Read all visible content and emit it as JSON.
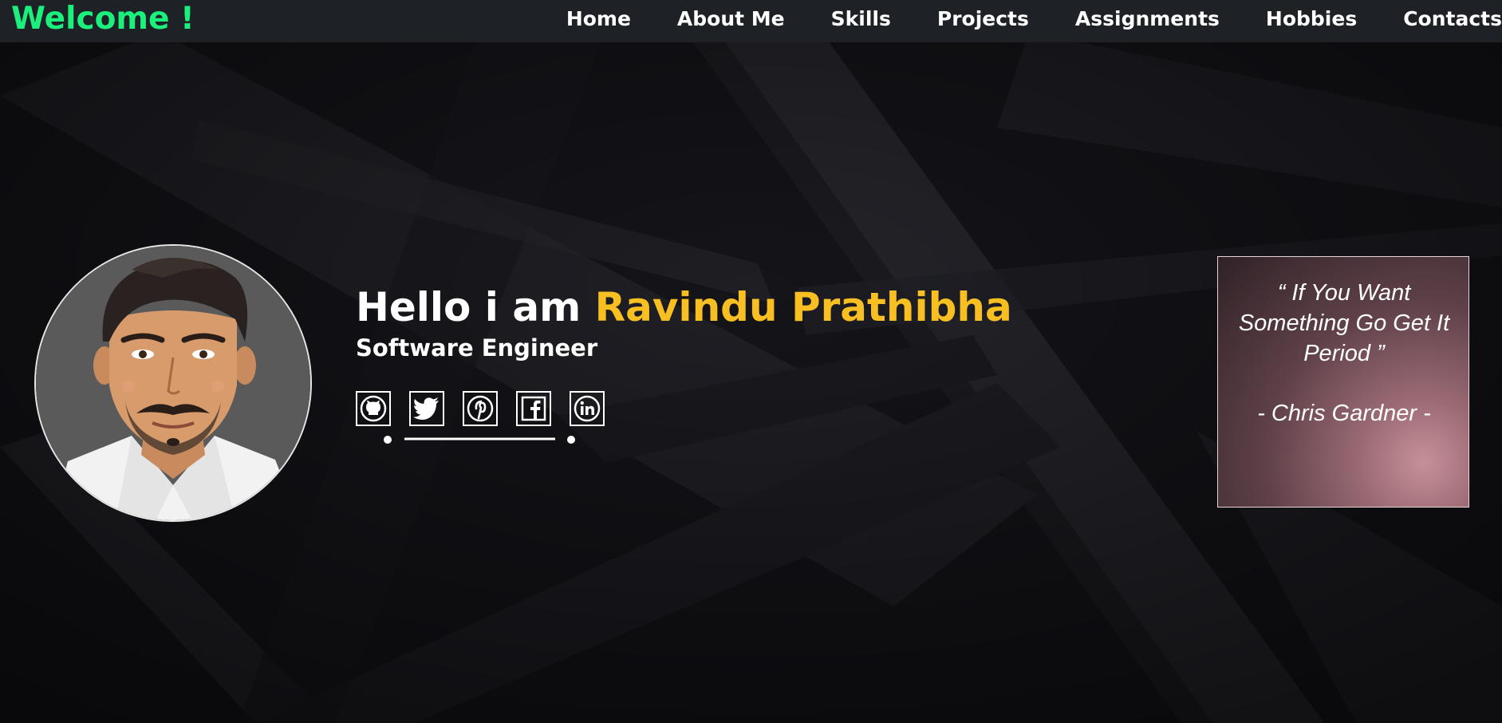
{
  "navbar": {
    "brand": "Welcome !",
    "links": [
      "Home",
      "About Me",
      "Skills",
      "Projects",
      "Assignments",
      "Hobbies",
      "Contacts"
    ]
  },
  "hero": {
    "greeting": "Hello i am ",
    "name": "Ravindu Prathibha",
    "role": "Software Engineer",
    "avatar_alt": "profile-avatar",
    "socials": [
      "github-icon",
      "twitter-icon",
      "pinterest-icon",
      "facebook-icon",
      "linkedin-icon"
    ]
  },
  "quote": {
    "text": "“ If You Want Something Go Get It Period ”",
    "author": "- Chris Gardner -"
  },
  "colors": {
    "brand": "#1cf07c",
    "name_accent": "#f7bf22",
    "navbar_bg": "#1e2126",
    "page_bg": "#121216"
  }
}
